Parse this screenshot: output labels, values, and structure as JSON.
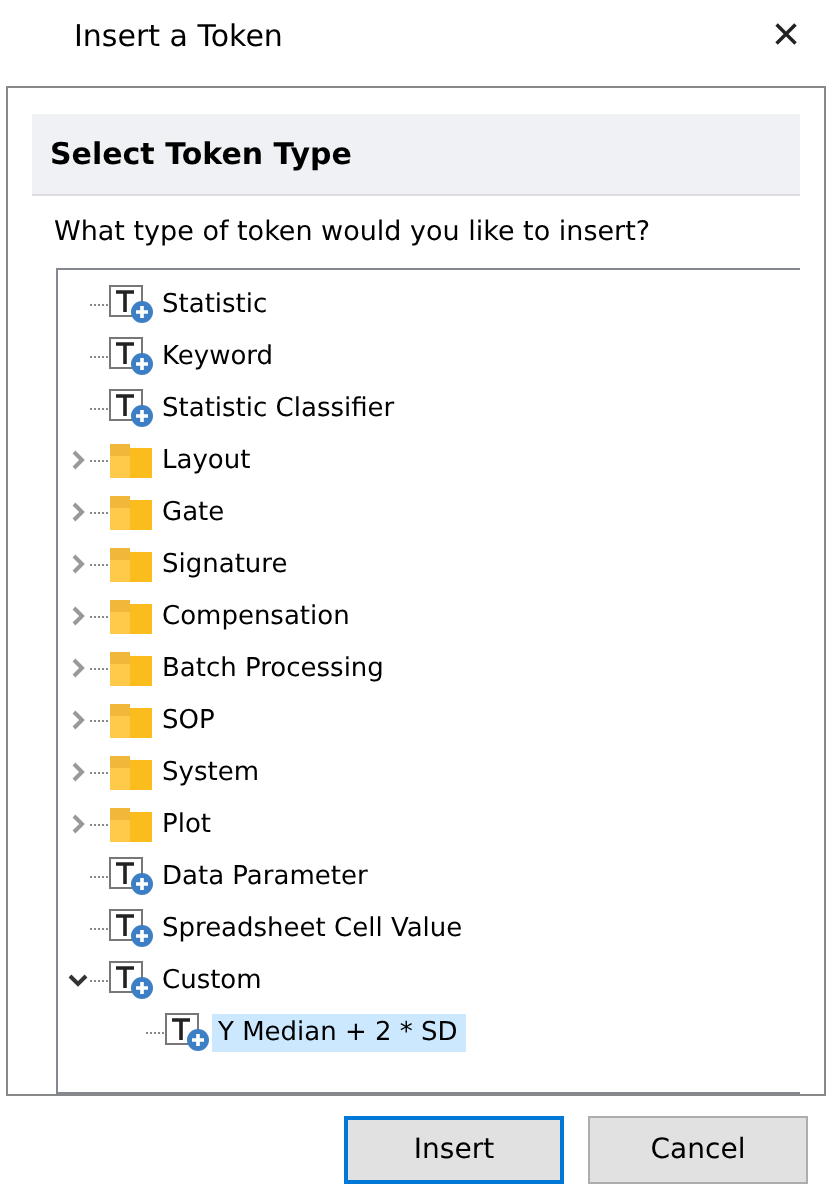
{
  "window": {
    "title": "Insert a Token",
    "close": "×"
  },
  "header": {
    "title": "Select Token Type"
  },
  "prompt": "What type of token would you like to insert?",
  "tree": [
    {
      "label": "Statistic",
      "kind": "token",
      "selected": false
    },
    {
      "label": "Keyword",
      "kind": "token",
      "selected": false
    },
    {
      "label": "Statistic Classifier",
      "kind": "token",
      "selected": false
    },
    {
      "label": "Layout",
      "kind": "folder",
      "expanded": false,
      "selected": false
    },
    {
      "label": "Gate",
      "kind": "folder",
      "expanded": false,
      "selected": false
    },
    {
      "label": "Signature",
      "kind": "folder",
      "expanded": false,
      "selected": false
    },
    {
      "label": "Compensation",
      "kind": "folder",
      "expanded": false,
      "selected": false
    },
    {
      "label": "Batch Processing",
      "kind": "folder",
      "expanded": false,
      "selected": false
    },
    {
      "label": "SOP",
      "kind": "folder",
      "expanded": false,
      "selected": false
    },
    {
      "label": "System",
      "kind": "folder",
      "expanded": false,
      "selected": false
    },
    {
      "label": "Plot",
      "kind": "folder",
      "expanded": false,
      "selected": false
    },
    {
      "label": "Data Parameter",
      "kind": "token",
      "selected": false
    },
    {
      "label": "Spreadsheet Cell Value",
      "kind": "token",
      "selected": false
    },
    {
      "label": "Custom",
      "kind": "token",
      "expanded": true,
      "selected": false,
      "children": [
        {
          "label": "Y Median + 2 * SD",
          "kind": "token",
          "selected": true
        }
      ]
    }
  ],
  "buttons": [
    {
      "label": "Insert",
      "default": true
    },
    {
      "label": "Cancel",
      "default": false
    }
  ]
}
